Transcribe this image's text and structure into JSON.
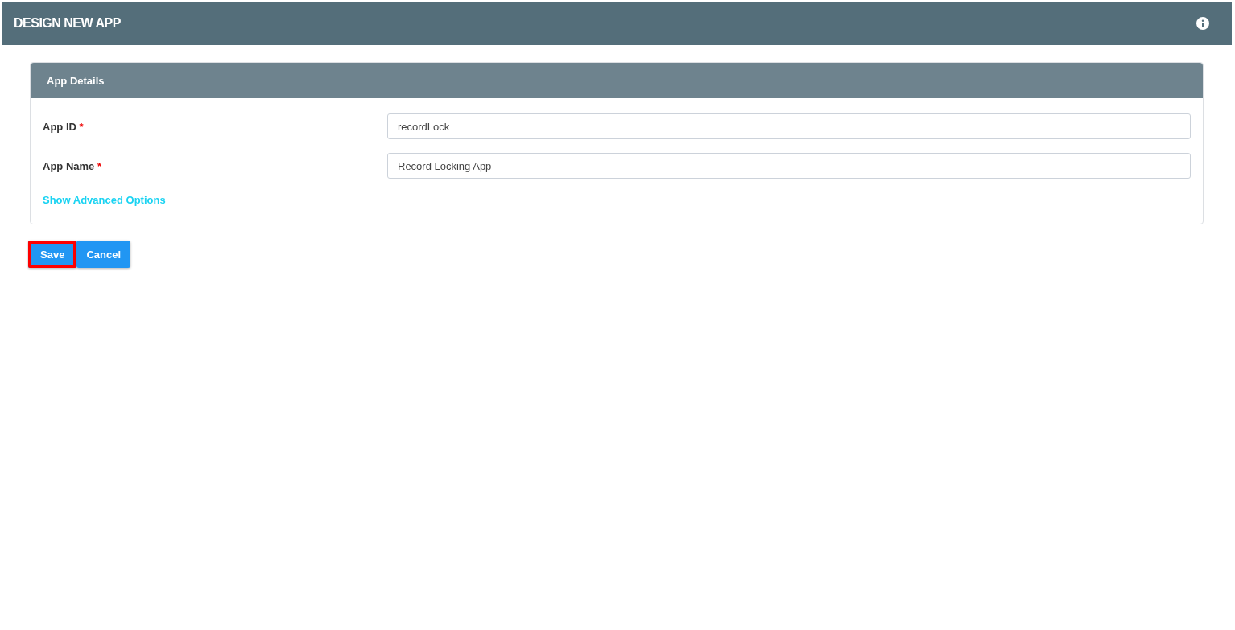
{
  "header": {
    "title": "DESIGN NEW APP"
  },
  "panel": {
    "title": "App Details",
    "fields": [
      {
        "label": "App ID",
        "required_mark": "*",
        "value": "recordLock"
      },
      {
        "label": "App Name",
        "required_mark": "*",
        "value": "Record Locking App"
      }
    ],
    "link": "Show Advanced Options"
  },
  "buttons": [
    {
      "label": "Save",
      "highlighted": true
    },
    {
      "label": "Cancel",
      "highlighted": false
    }
  ]
}
